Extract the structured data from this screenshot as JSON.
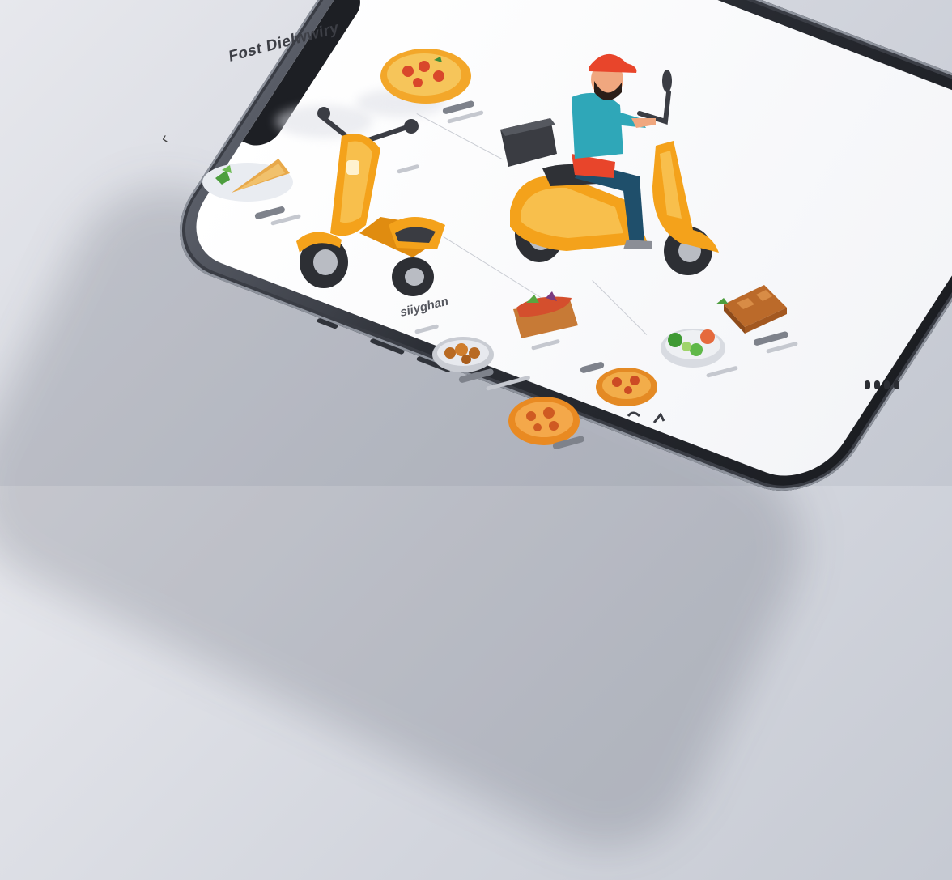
{
  "app": {
    "title": "Fost Dielwwiry",
    "back_icon": "back-icon",
    "section_title": "siiyghan"
  },
  "colors": {
    "accent": "#f4a21b",
    "accent_dark": "#d97d07",
    "rider_cap": "#e8452b",
    "rider_shirt": "#2fa7b8",
    "rider_pants": "#1f4f6b",
    "delivery_box": "#3a3c42",
    "background": "#dcdee4"
  },
  "food_items": [
    {
      "icon": "pizza-icon"
    },
    {
      "icon": "quesadilla-icon"
    },
    {
      "icon": "noodle-bowl-icon"
    },
    {
      "icon": "fried-chicken-icon"
    },
    {
      "icon": "salad-bowl-icon"
    },
    {
      "icon": "waffle-icon"
    },
    {
      "icon": "pasta-plate-icon"
    },
    {
      "icon": "curry-plate-icon"
    }
  ],
  "scooters": [
    {
      "icon": "parked-scooter-icon"
    },
    {
      "icon": "delivery-scooter-rider-icon"
    }
  ]
}
